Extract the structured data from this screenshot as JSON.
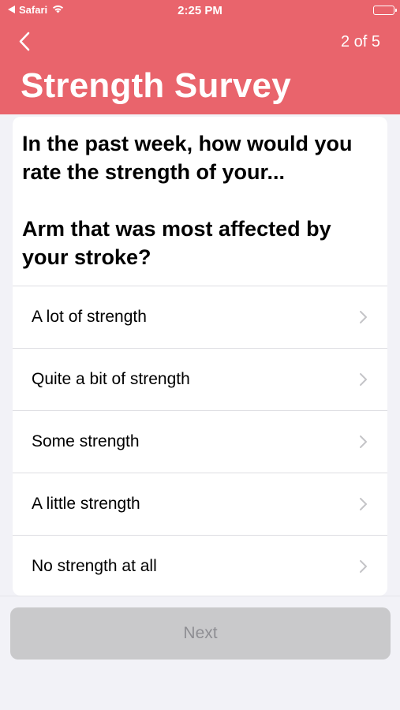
{
  "status_bar": {
    "back_app": "Safari",
    "time": "2:25 PM"
  },
  "nav": {
    "step": "2 of 5"
  },
  "page": {
    "title": "Strength Survey"
  },
  "question": {
    "prompt": "In the past week, how would you rate the strength of your...",
    "subject": "Arm that was most affected by your stroke?"
  },
  "options": [
    {
      "label": "A lot of strength"
    },
    {
      "label": "Quite a bit of strength"
    },
    {
      "label": "Some strength"
    },
    {
      "label": "A little strength"
    },
    {
      "label": "No strength at all"
    }
  ],
  "footer": {
    "next_label": "Next",
    "next_enabled": false
  },
  "colors": {
    "header_bg": "#e9646c",
    "page_bg": "#f2f2f7",
    "next_disabled_bg": "#c9c9cb",
    "next_disabled_text": "#8e8e93"
  }
}
